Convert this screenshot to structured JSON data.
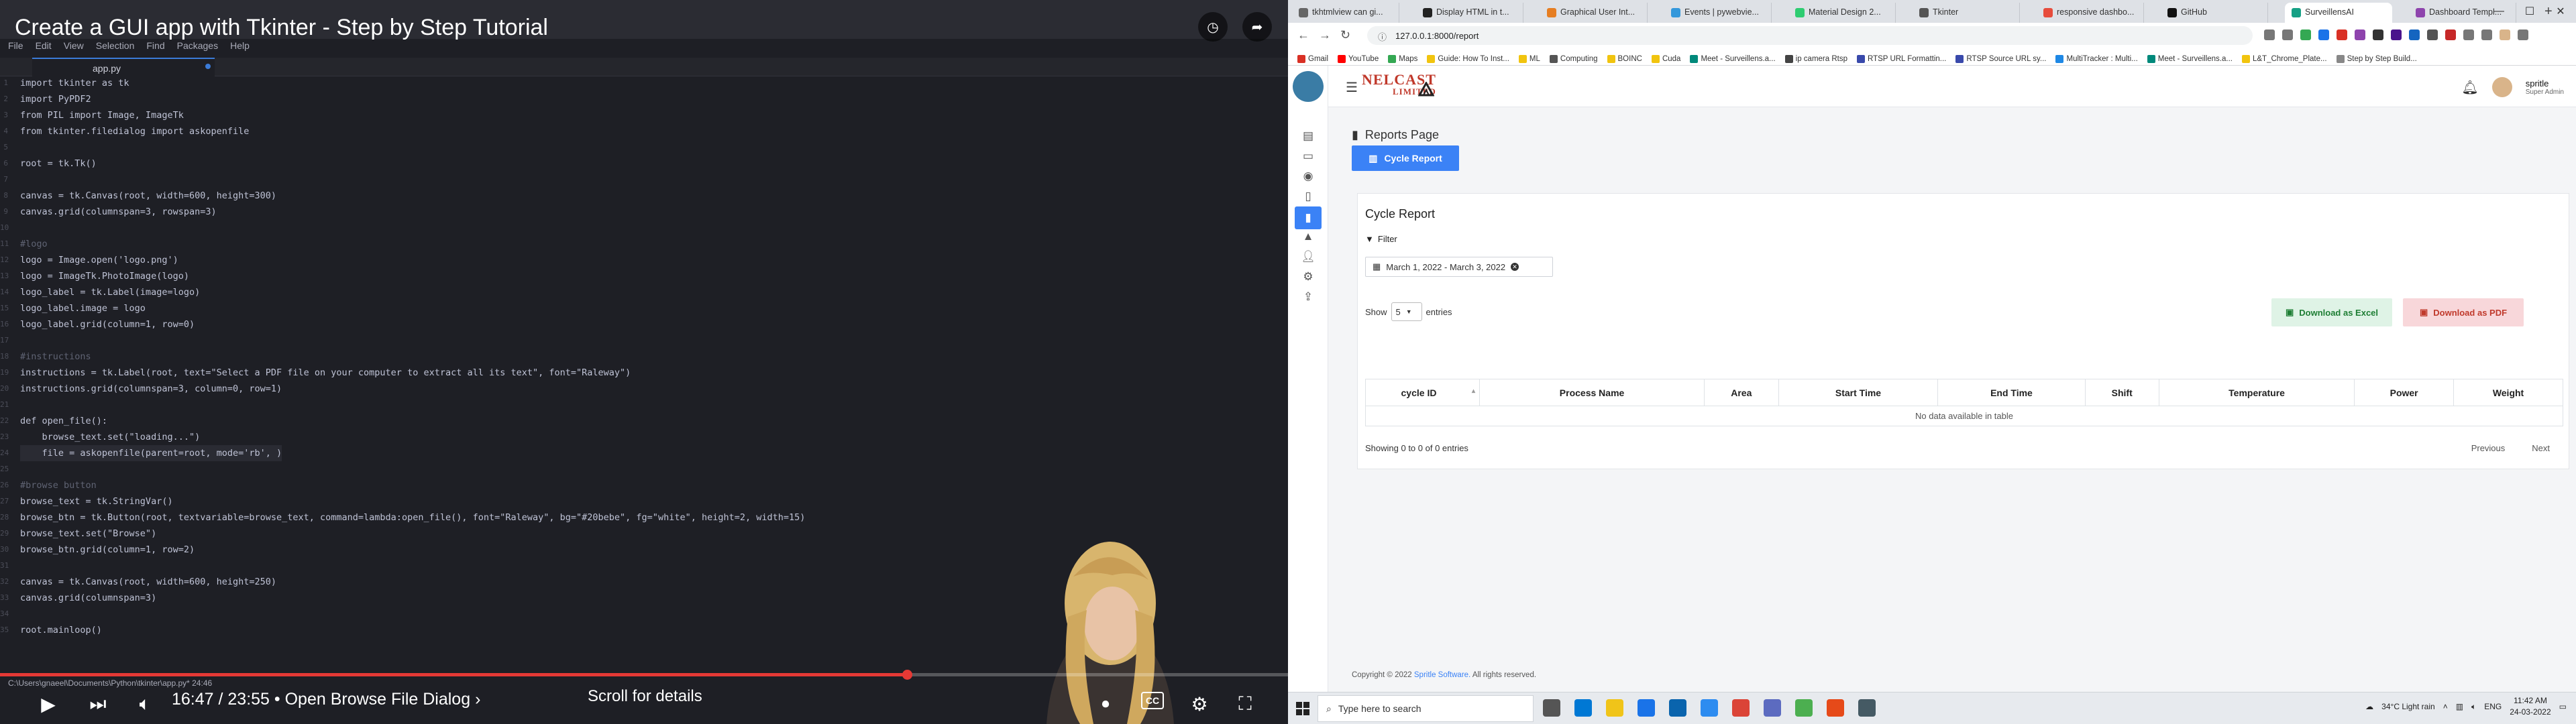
{
  "video": {
    "title": "Create a GUI app with Tkinter - Step by Step Tutorial",
    "editor_menu": [
      "File",
      "Edit",
      "View",
      "Selection",
      "Find",
      "Packages",
      "Help"
    ],
    "editor_tab": "app.py",
    "code_lines": [
      {
        "n": "1",
        "t": "import tkinter as tk",
        "c": ""
      },
      {
        "n": "2",
        "t": "import PyPDF2",
        "c": ""
      },
      {
        "n": "3",
        "t": "from PIL import Image, ImageTk",
        "c": ""
      },
      {
        "n": "4",
        "t": "from tkinter.filedialog import askopenfile",
        "c": ""
      },
      {
        "n": "5",
        "t": "",
        "c": ""
      },
      {
        "n": "6",
        "t": "root = tk.Tk()",
        "c": ""
      },
      {
        "n": "7",
        "t": "",
        "c": ""
      },
      {
        "n": "8",
        "t": "canvas = tk.Canvas(root, width=600, height=300)",
        "c": ""
      },
      {
        "n": "9",
        "t": "canvas.grid(columnspan=3, rowspan=3)",
        "c": ""
      },
      {
        "n": "10",
        "t": "",
        "c": ""
      },
      {
        "n": "11",
        "t": "#logo",
        "c": "cm"
      },
      {
        "n": "12",
        "t": "logo = Image.open('logo.png')",
        "c": ""
      },
      {
        "n": "13",
        "t": "logo = ImageTk.PhotoImage(logo)",
        "c": ""
      },
      {
        "n": "14",
        "t": "logo_label = tk.Label(image=logo)",
        "c": ""
      },
      {
        "n": "15",
        "t": "logo_label.image = logo",
        "c": ""
      },
      {
        "n": "16",
        "t": "logo_label.grid(column=1, row=0)",
        "c": ""
      },
      {
        "n": "17",
        "t": "",
        "c": ""
      },
      {
        "n": "18",
        "t": "#instructions",
        "c": "cm"
      },
      {
        "n": "19",
        "t": "instructions = tk.Label(root, text=\"Select a PDF file on your computer to extract all its text\", font=\"Raleway\")",
        "c": ""
      },
      {
        "n": "20",
        "t": "instructions.grid(columnspan=3, column=0, row=1)",
        "c": ""
      },
      {
        "n": "21",
        "t": "",
        "c": ""
      },
      {
        "n": "22",
        "t": "def open_file():",
        "c": ""
      },
      {
        "n": "23",
        "t": "    browse_text.set(\"loading...\")",
        "c": ""
      },
      {
        "n": "24",
        "t": "    file = askopenfile(parent=root, mode='rb', )",
        "c": "hl"
      },
      {
        "n": "25",
        "t": "",
        "c": ""
      },
      {
        "n": "26",
        "t": "#browse button",
        "c": "cm"
      },
      {
        "n": "27",
        "t": "browse_text = tk.StringVar()",
        "c": ""
      },
      {
        "n": "28",
        "t": "browse_btn = tk.Button(root, textvariable=browse_text, command=lambda:open_file(), font=\"Raleway\", bg=\"#20bebe\", fg=\"white\", height=2, width=15)",
        "c": ""
      },
      {
        "n": "29",
        "t": "browse_text.set(\"Browse\")",
        "c": ""
      },
      {
        "n": "30",
        "t": "browse_btn.grid(column=1, row=2)",
        "c": ""
      },
      {
        "n": "31",
        "t": "",
        "c": ""
      },
      {
        "n": "32",
        "t": "canvas = tk.Canvas(root, width=600, height=250)",
        "c": ""
      },
      {
        "n": "33",
        "t": "canvas.grid(columnspan=3)",
        "c": ""
      },
      {
        "n": "34",
        "t": "",
        "c": ""
      },
      {
        "n": "35",
        "t": "root.mainloop()",
        "c": ""
      }
    ],
    "status_path": "C:\\Users\\gnaeel\\Documents\\Python\\tkinter\\app.py*   24:46",
    "timecode": "16:47 / 23:55 • Open Browse File Dialog ›",
    "scroll_for_details": "Scroll for details",
    "cc_label": "CC",
    "progress_fraction": 0.704,
    "accent_color": "#e53935"
  },
  "browser": {
    "tabs": [
      {
        "label": "tkhtmlview can gi...",
        "color": "#666"
      },
      {
        "label": "Display HTML in t...",
        "color": "#222"
      },
      {
        "label": "Graphical User Int...",
        "color": "#e67e22"
      },
      {
        "label": "Events | pywebvie...",
        "color": "#3498db"
      },
      {
        "label": "Material Design 2...",
        "color": "#2ecc71"
      },
      {
        "label": "Tkinter",
        "color": "#555"
      },
      {
        "label": "responsive dashbo...",
        "color": "#e74c3c"
      },
      {
        "label": "GitHub",
        "color": "#111"
      },
      {
        "label": "SurveillensAI",
        "color": "#16a085"
      },
      {
        "label": "Dashboard Templ...",
        "color": "#8e44ad"
      }
    ],
    "active_tab_index": 8,
    "url": "127.0.0.1:8000/report",
    "bookmarks": [
      {
        "label": "Gmail",
        "color": "#d93025"
      },
      {
        "label": "YouTube",
        "color": "#ff0000"
      },
      {
        "label": "Maps",
        "color": "#34a853"
      },
      {
        "label": "Guide: How To Inst...",
        "color": "#f1c40f"
      },
      {
        "label": "ML",
        "color": "#f1c40f"
      },
      {
        "label": "Computing",
        "color": "#555"
      },
      {
        "label": "BOINC",
        "color": "#f1c40f"
      },
      {
        "label": "Cuda",
        "color": "#f1c40f"
      },
      {
        "label": "Meet - Surveillens.a...",
        "color": "#00897b"
      },
      {
        "label": "ip camera Rtsp",
        "color": "#444"
      },
      {
        "label": "RTSP URL Formattin...",
        "color": "#3949ab"
      },
      {
        "label": "RTSP Source URL sy...",
        "color": "#3949ab"
      },
      {
        "label": "MultiTracker : Multi...",
        "color": "#1e88e5"
      },
      {
        "label": "Meet - Surveillens.a...",
        "color": "#00897b"
      },
      {
        "label": "L&T_Chrome_Plate...",
        "color": "#f1c40f"
      },
      {
        "label": "Step by Step Build...",
        "color": "#888"
      }
    ]
  },
  "app": {
    "brand_top": "NELCAST",
    "brand_bottom": "LIMITED",
    "user_name": "spritle",
    "user_role": "Super Admin",
    "page_title": "Reports Page",
    "cycle_button": "Cycle Report",
    "card_title": "Cycle Report",
    "filter_label": "Filter",
    "date_range": "March 1, 2022 - March 3, 2022",
    "show_label": "Show",
    "entries_value": "5",
    "entries_label": "entries",
    "excel_button": "Download as Excel",
    "pdf_button": "Download as PDF",
    "columns": [
      "cycle ID",
      "Process Name",
      "Area",
      "Start Time",
      "End Time",
      "Shift",
      "Temperature",
      "Power",
      "Weight"
    ],
    "empty_message": "No data available in table",
    "showing_text": "Showing 0 to 0 of 0 entries",
    "previous": "Previous",
    "next": "Next",
    "copyright_prefix": "Copyright © 2022",
    "copyright_link": "Spritle Software.",
    "copyright_suffix": "All rights reserved.",
    "primary_color": "#3b82f6"
  },
  "taskbar": {
    "search_placeholder": "Type here to search",
    "weather": "34°C  Light rain",
    "lang": "ENG",
    "time": "11:42 AM",
    "date": "24-03-2022"
  }
}
